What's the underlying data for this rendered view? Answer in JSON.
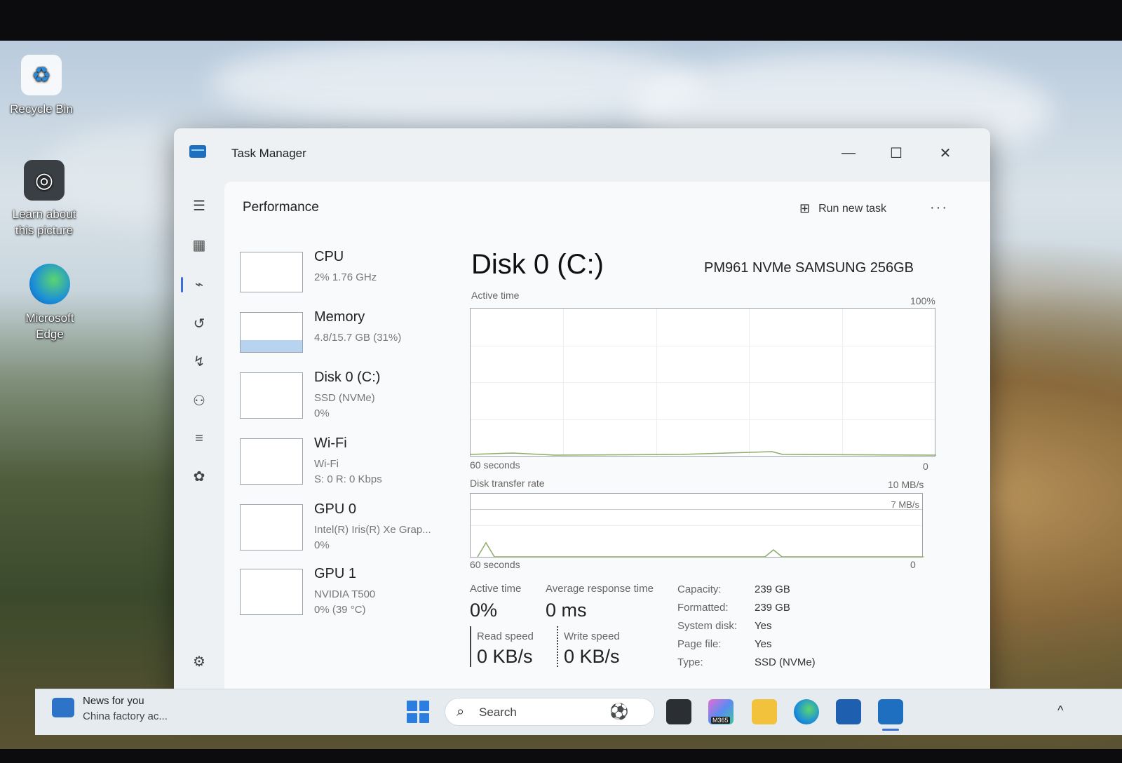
{
  "desktop": {
    "icons": [
      {
        "label": "Recycle Bin"
      },
      {
        "label": "Learn about this picture"
      },
      {
        "label": "Microsoft Edge"
      }
    ]
  },
  "window": {
    "title": "Task Manager",
    "controls": {
      "minimize": "—",
      "maximize": "☐",
      "close": "✕"
    }
  },
  "header": {
    "page_title": "Performance",
    "run_new_task": "Run new task",
    "more": "···"
  },
  "devices": [
    {
      "name": "CPU",
      "line1": "2%  1.76 GHz",
      "line2": ""
    },
    {
      "name": "Memory",
      "line1": "4.8/15.7 GB (31%)",
      "line2": ""
    },
    {
      "name": "Disk 0 (C:)",
      "line1": "SSD (NVMe)",
      "line2": "0%"
    },
    {
      "name": "Wi-Fi",
      "line1": "Wi-Fi",
      "line2": "S: 0  R: 0 Kbps"
    },
    {
      "name": "GPU 0",
      "line1": "Intel(R) Iris(R) Xe Grap...",
      "line2": "0%"
    },
    {
      "name": "GPU 1",
      "line1": "NVIDIA T500",
      "line2": "0%  (39 °C)"
    }
  ],
  "memory_fill_fraction": 0.31,
  "detail": {
    "title": "Disk 0 (C:)",
    "model": "PM961 NVMe SAMSUNG 256GB",
    "active_graph": {
      "label": "Active time",
      "max": "100%",
      "time": "60 seconds",
      "min": "0"
    },
    "transfer_graph": {
      "label": "Disk transfer rate",
      "max": "10 MB/s",
      "inner_max": "7 MB/s",
      "time": "60 seconds",
      "min": "0"
    },
    "stats": {
      "active_time_label": "Active time",
      "active_time_value": "0%",
      "avg_response_label": "Average response time",
      "avg_response_value": "0 ms",
      "read_label": "Read speed",
      "read_value": "0 KB/s",
      "write_label": "Write speed",
      "write_value": "0 KB/s"
    },
    "properties": [
      {
        "label": "Capacity:",
        "value": "239 GB"
      },
      {
        "label": "Formatted:",
        "value": "239 GB"
      },
      {
        "label": "System disk:",
        "value": "Yes"
      },
      {
        "label": "Page file:",
        "value": "Yes"
      },
      {
        "label": "Type:",
        "value": "SSD (NVMe)"
      }
    ]
  },
  "taskbar": {
    "news_title": "News for you",
    "news_text": "China factory ac...",
    "search_label": "Search",
    "m365_label": "M365",
    "chevron": "^"
  },
  "colors": {
    "accent": "#3b6fd6",
    "memory_fill": "#b7d3ef",
    "graph_trace": "#8faa6a"
  }
}
